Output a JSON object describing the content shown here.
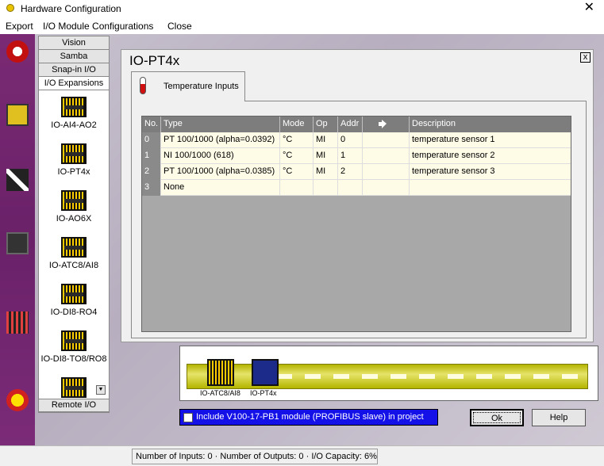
{
  "window": {
    "title": "Hardware Configuration",
    "close_glyph": "✕"
  },
  "menu": {
    "items": [
      "Export",
      "I/O Module Configurations",
      "Close"
    ]
  },
  "palette": {
    "tabs": [
      "Vision",
      "Samba",
      "Snap-in I/O",
      "I/O Expansions"
    ],
    "items": [
      "IO-AI4-AO2",
      "IO-PT4x",
      "IO-AO6X",
      "IO-ATC8/AI8",
      "IO-DI8-RO4",
      "IO-DI8-TO8/RO8"
    ],
    "bottom_tab": "Remote I/O"
  },
  "dialog": {
    "title": "IO-PT4x",
    "close_glyph": "x",
    "tab_label": "Temperature Inputs",
    "table": {
      "headers": {
        "no": "No.",
        "type": "Type",
        "mode": "Mode",
        "op": "Op",
        "addr": "Addr",
        "description": "Description"
      },
      "rows": [
        {
          "no": "0",
          "type": "PT 100/1000 (alpha=0.0392)",
          "mode": "°C",
          "op": "MI",
          "addr": "0",
          "description": "temperature sensor 1"
        },
        {
          "no": "1",
          "type": "NI 100/1000 (618)",
          "mode": "°C",
          "op": "MI",
          "addr": "1",
          "description": "temperature sensor 2"
        },
        {
          "no": "2",
          "type": "PT 100/1000 (alpha=0.0385)",
          "mode": "°C",
          "op": "MI",
          "addr": "2",
          "description": "temperature sensor 3"
        },
        {
          "no": "3",
          "type": "None",
          "mode": "",
          "op": "",
          "addr": "",
          "description": ""
        }
      ]
    }
  },
  "rail": {
    "modules": [
      "IO-ATC8/AI8",
      "IO-PT4x"
    ]
  },
  "include_profibus": {
    "label": "Include V100-17-PB1 module (PROFIBUS slave) in project",
    "checked": false
  },
  "buttons": {
    "ok": "Ok",
    "help": "Help"
  },
  "status": {
    "text": "Number of Inputs: 0  ·  Number of Outputs: 0  ·  I/O Capacity: 6%"
  }
}
